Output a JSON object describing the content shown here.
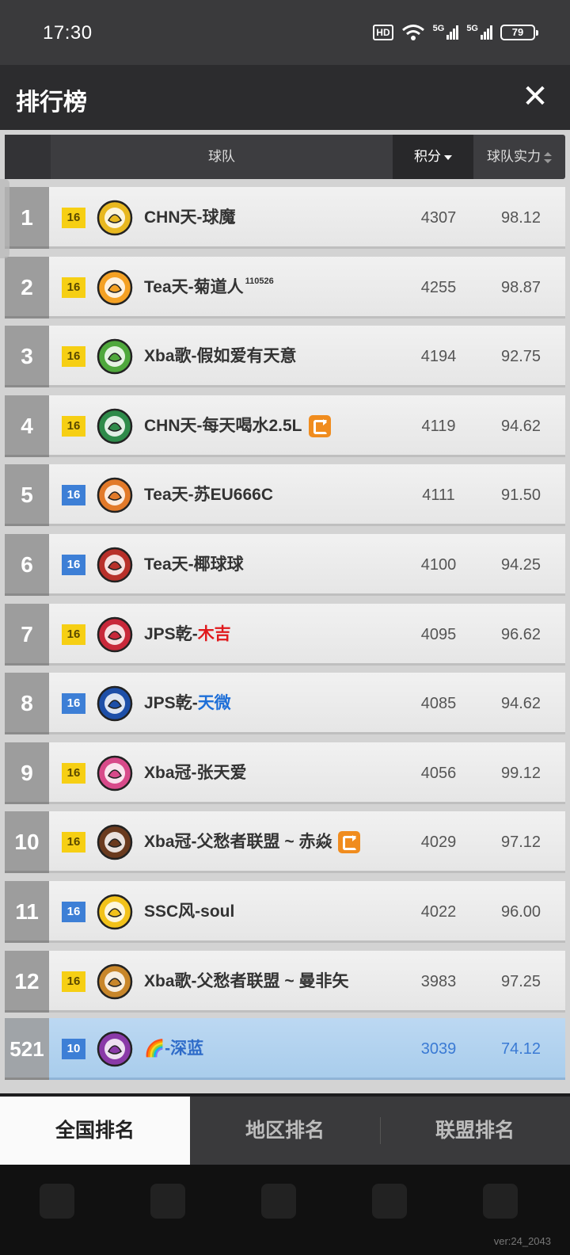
{
  "status": {
    "time": "17:30",
    "hd": "HD",
    "net1": "5G",
    "net2": "5G",
    "battery": "79"
  },
  "header": {
    "title": "排行榜",
    "close": "✕"
  },
  "table": {
    "col_team": "球队",
    "col_points": "积分",
    "col_strength": "球队实力"
  },
  "rows": [
    {
      "rank": "1",
      "level": "16",
      "level_color": "yellow",
      "name": "CHN天-球魔",
      "points": "4307",
      "strength": "98.12",
      "logo_color": "#e8b820"
    },
    {
      "rank": "2",
      "level": "16",
      "level_color": "yellow",
      "name": "Tea天-菊道人",
      "sup": "110526",
      "points": "4255",
      "strength": "98.87",
      "logo_color": "#f4a124"
    },
    {
      "rank": "3",
      "level": "16",
      "level_color": "yellow",
      "name": "Xba歌-假如爱有天意",
      "points": "4194",
      "strength": "92.75",
      "logo_color": "#4fa83c"
    },
    {
      "rank": "4",
      "level": "16",
      "level_color": "yellow",
      "name": "CHN天-每天喝水2.5L",
      "points": "4119",
      "strength": "94.62",
      "logo_color": "#2e8b4a",
      "swap": true
    },
    {
      "rank": "5",
      "level": "16",
      "level_color": "blue",
      "name": "Tea天-苏EU666C",
      "points": "4111",
      "strength": "91.50",
      "logo_color": "#e27a2a"
    },
    {
      "rank": "6",
      "level": "16",
      "level_color": "blue",
      "name": "Tea天-椰球球",
      "points": "4100",
      "strength": "94.25",
      "logo_color": "#b8302a"
    },
    {
      "rank": "7",
      "level": "16",
      "level_color": "yellow",
      "name_prefix": "JPS乾-",
      "name_colored": "木吉",
      "name_color": "red",
      "points": "4095",
      "strength": "96.62",
      "logo_color": "#c8283a"
    },
    {
      "rank": "8",
      "level": "16",
      "level_color": "blue",
      "name_prefix": "JPS乾-",
      "name_colored": "天微",
      "name_color": "blue",
      "points": "4085",
      "strength": "94.62",
      "logo_color": "#1d4fa8"
    },
    {
      "rank": "9",
      "level": "16",
      "level_color": "yellow",
      "name": "Xba冠-张天爱",
      "points": "4056",
      "strength": "99.12",
      "logo_color": "#d84a8a"
    },
    {
      "rank": "10",
      "level": "16",
      "level_color": "yellow",
      "name": "Xba冠-父愁者联盟 ~ 赤焱",
      "points": "4029",
      "strength": "97.12",
      "logo_color": "#6a3a1e",
      "swap": true
    },
    {
      "rank": "11",
      "level": "16",
      "level_color": "blue",
      "name": "SSC风-soul",
      "points": "4022",
      "strength": "96.00",
      "logo_color": "#f2c21a"
    },
    {
      "rank": "12",
      "level": "16",
      "level_color": "yellow",
      "name": "Xba歌-父愁者联盟 ~ 曼非矢",
      "points": "3983",
      "strength": "97.25",
      "logo_color": "#c8862a"
    }
  ],
  "me": {
    "rank": "521",
    "level": "10",
    "name": "🌈-深蓝",
    "points": "3039",
    "strength": "74.12",
    "logo_color": "#8a3aa8"
  },
  "tabs": [
    "全国排名",
    "地区排名",
    "联盟排名"
  ],
  "version": "ver:24_2043"
}
